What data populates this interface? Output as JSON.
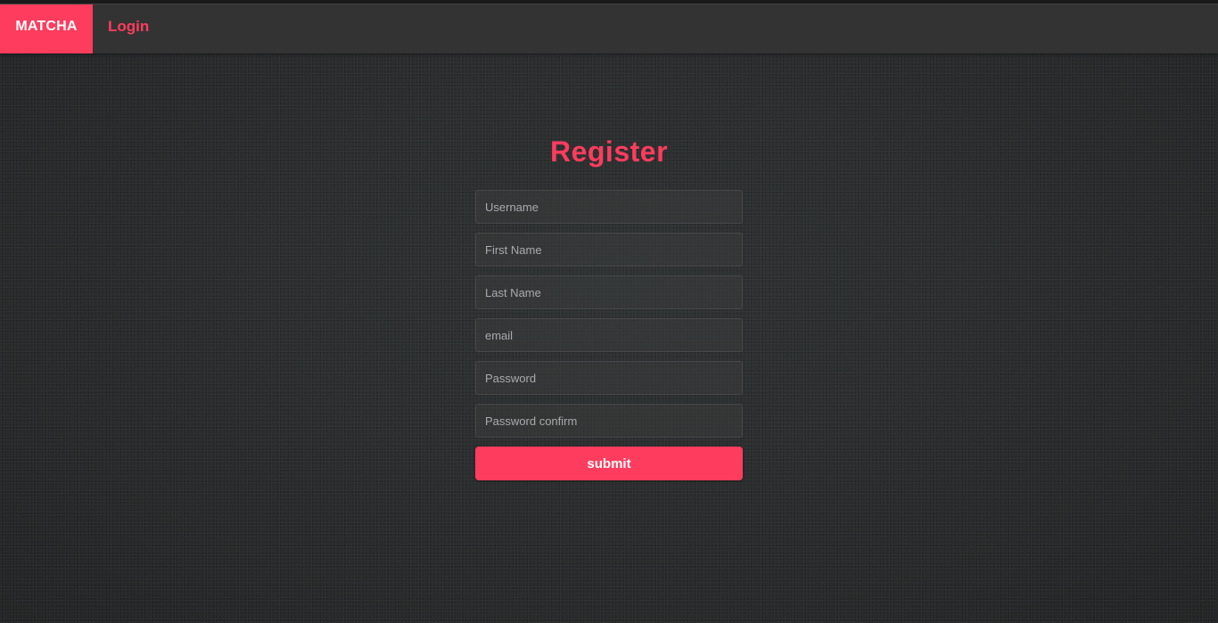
{
  "colors": {
    "accent": "#fe3c5e",
    "navbar": "#333333",
    "background": "#2c2e2f"
  },
  "navbar": {
    "brand": "MATCHA",
    "login_link": "Login"
  },
  "register": {
    "title": "Register",
    "fields": {
      "username": {
        "placeholder": "Username",
        "value": ""
      },
      "first_name": {
        "placeholder": "First Name",
        "value": ""
      },
      "last_name": {
        "placeholder": "Last Name",
        "value": ""
      },
      "email": {
        "placeholder": "email",
        "value": ""
      },
      "password": {
        "placeholder": "Password",
        "value": ""
      },
      "password_confirm": {
        "placeholder": "Password confirm",
        "value": ""
      }
    },
    "submit_label": "submit"
  }
}
